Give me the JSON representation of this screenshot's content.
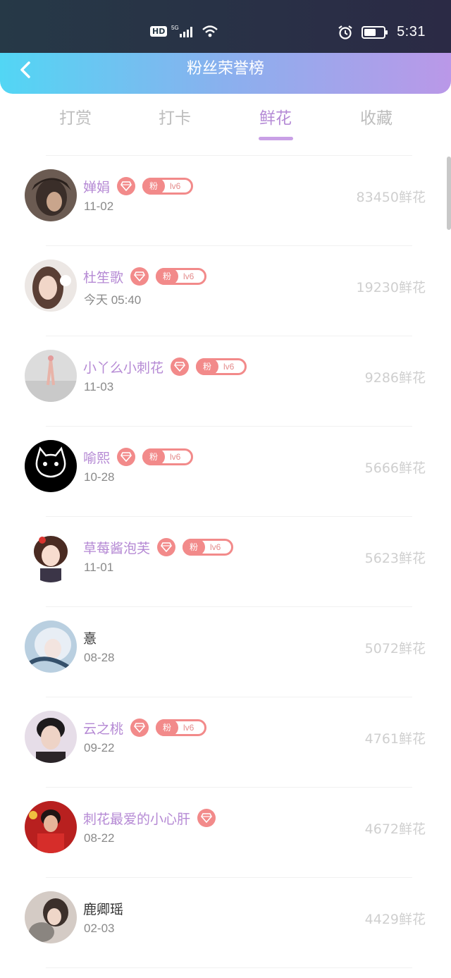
{
  "status_bar": {
    "hd": "HD",
    "network": "5G",
    "time": "5:31"
  },
  "header": {
    "title": "粉丝荣誉榜"
  },
  "tabs": [
    {
      "label": "打赏",
      "active": false
    },
    {
      "label": "打卡",
      "active": false
    },
    {
      "label": "鲜花",
      "active": true
    },
    {
      "label": "收藏",
      "active": false
    }
  ],
  "badge": {
    "fan": "粉",
    "level": "lv6"
  },
  "fans": [
    {
      "name": "婵娟",
      "date": "11-02",
      "amount": "83450鲜花",
      "diamond": true,
      "fan_badge": true
    },
    {
      "name": "杜笙歌",
      "date": "今天 05:40",
      "amount": "19230鲜花",
      "diamond": true,
      "fan_badge": true
    },
    {
      "name": "小丫么小刺花",
      "date": "11-03",
      "amount": "9286鲜花",
      "diamond": true,
      "fan_badge": true
    },
    {
      "name": "喻熙",
      "date": "10-28",
      "amount": "5666鲜花",
      "diamond": true,
      "fan_badge": true
    },
    {
      "name": "草莓酱泡芙",
      "date": "11-01",
      "amount": "5623鲜花",
      "diamond": true,
      "fan_badge": true
    },
    {
      "name": "憙",
      "date": "08-28",
      "amount": "5072鲜花",
      "diamond": false,
      "fan_badge": false
    },
    {
      "name": "云之桃",
      "date": "09-22",
      "amount": "4761鲜花",
      "diamond": true,
      "fan_badge": true
    },
    {
      "name": "刺花最爱的小心肝",
      "date": "08-22",
      "amount": "4672鲜花",
      "diamond": true,
      "fan_badge": false
    },
    {
      "name": "鹿卿瑶",
      "date": "02-03",
      "amount": "4429鲜花",
      "diamond": false,
      "fan_badge": false
    }
  ],
  "colors": {
    "header_gradient": [
      "#52d6f4",
      "#8ab0ee",
      "#ba98e8"
    ],
    "active_tab": "#b58bd6",
    "name_vip": "#b589d4",
    "badge": "#f28a8a",
    "amount": "#cfcfcf"
  }
}
